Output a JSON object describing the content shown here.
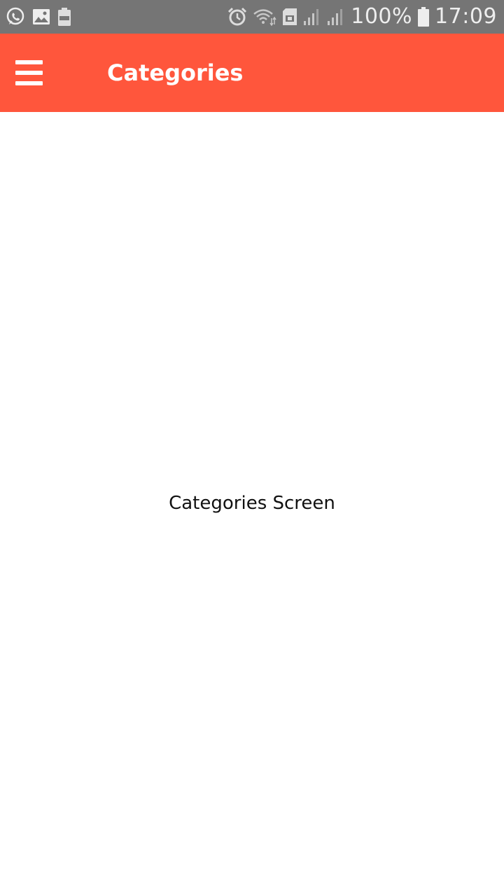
{
  "status_bar": {
    "left_icons": [
      "whatsapp-icon",
      "image-icon",
      "battery-saver-icon"
    ],
    "right_icons": [
      "alarm-icon",
      "wifi-icon",
      "sim-icon",
      "signal-icon",
      "signal-icon",
      "battery-icon"
    ],
    "battery_percent": "100%",
    "time": "17:09",
    "bg_color": "#757575"
  },
  "app_bar": {
    "title": "Categories",
    "menu_icon": "hamburger-menu-icon",
    "bg_color": "#ff563c"
  },
  "content": {
    "message": "Categories Screen"
  }
}
